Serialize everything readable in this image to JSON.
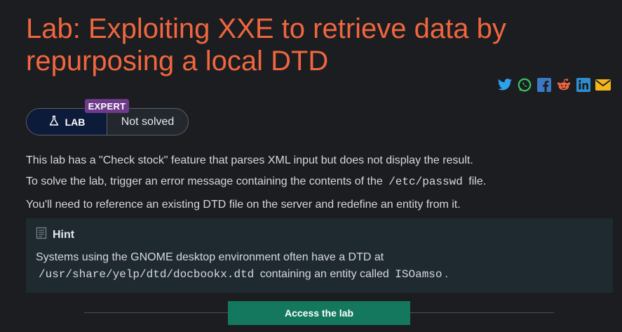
{
  "page": {
    "title": "Lab: Exploiting XXE to retrieve data by repurposing a local DTD"
  },
  "share": {
    "icons": [
      "twitter-icon",
      "whatsapp-icon",
      "facebook-icon",
      "reddit-icon",
      "linkedin-icon",
      "email-icon"
    ]
  },
  "status": {
    "level": "EXPERT",
    "lab_label": "LAB",
    "state": "Not solved"
  },
  "description": {
    "line1": "This lab has a \"Check stock\" feature that parses XML input but does not display the result.",
    "line2_pre": "To solve the lab, trigger an error message containing the contents of the",
    "line2_code": "/etc/passwd",
    "line2_post": "file.",
    "line3": "You'll need to reference an existing DTD file on the server and redefine an entity from it."
  },
  "hint": {
    "heading": "Hint",
    "text_pre": "Systems using the GNOME desktop environment often have a DTD at",
    "path": "/usr/share/yelp/dtd/docbookx.dtd",
    "text_mid": "containing an entity called",
    "entity": "ISOamso",
    "text_post": "."
  },
  "actions": {
    "access_label": "Access the lab"
  },
  "colors": {
    "background": "#1c1d20",
    "title": "#f0663f",
    "badge": "#6e3a8a",
    "button": "#14785f",
    "hint_bg": "#1f2a30"
  }
}
